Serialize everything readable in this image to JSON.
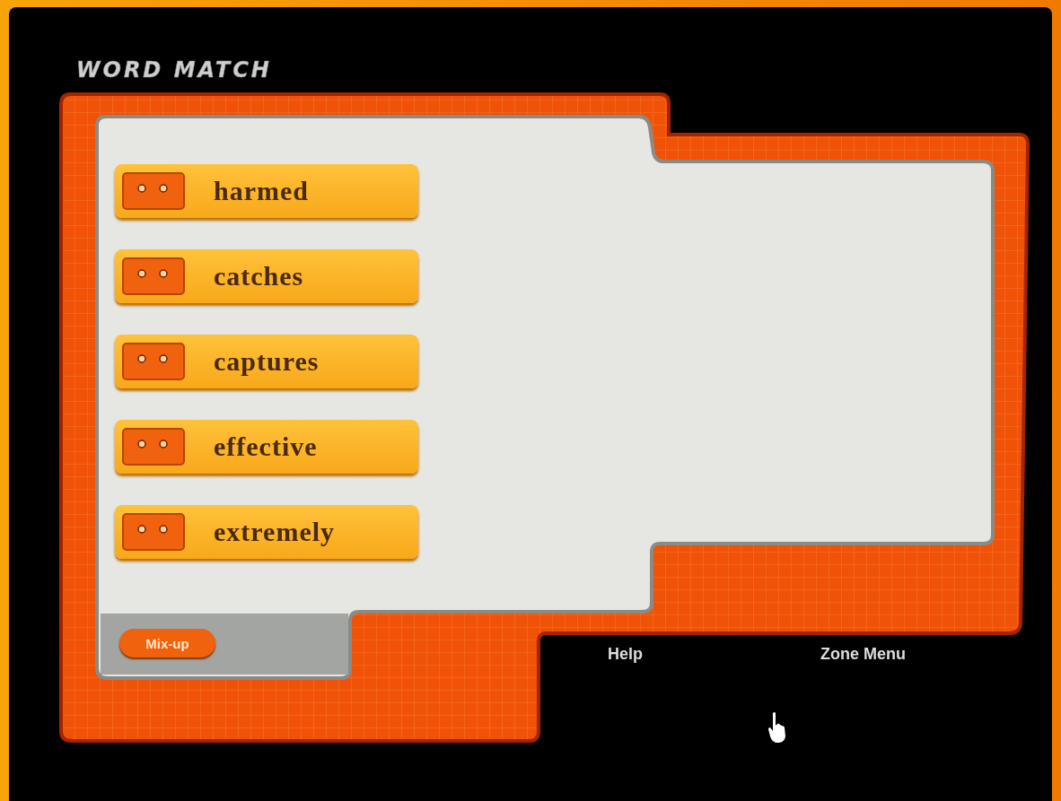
{
  "title": "WORD MATCH",
  "words": [
    {
      "label": "harmed"
    },
    {
      "label": "catches"
    },
    {
      "label": "captures"
    },
    {
      "label": "effective"
    },
    {
      "label": "extremely"
    }
  ],
  "mixup_button": "Mix-up",
  "nav": [
    {
      "label": "Help"
    },
    {
      "label": "Zone Menu"
    }
  ]
}
